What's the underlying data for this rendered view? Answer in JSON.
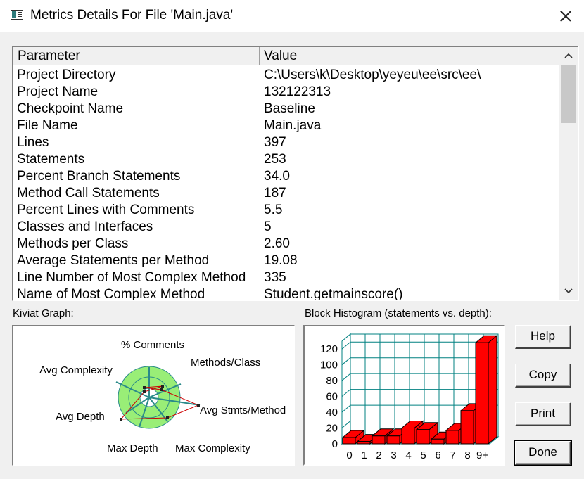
{
  "window": {
    "title": "Metrics Details For File 'Main.java'"
  },
  "table": {
    "headers": {
      "parameter": "Parameter",
      "value": "Value"
    },
    "rows": [
      {
        "p": "Project Directory",
        "v": "C:\\Users\\k\\Desktop\\yeyeu\\ee\\src\\ee\\"
      },
      {
        "p": "Project Name",
        "v": "132122313"
      },
      {
        "p": "Checkpoint Name",
        "v": "Baseline"
      },
      {
        "p": "File Name",
        "v": "Main.java"
      },
      {
        "p": "Lines",
        "v": "397"
      },
      {
        "p": "Statements",
        "v": "253"
      },
      {
        "p": "Percent Branch Statements",
        "v": "34.0"
      },
      {
        "p": "Method Call Statements",
        "v": "187"
      },
      {
        "p": "Percent Lines with Comments",
        "v": "5.5"
      },
      {
        "p": "Classes and Interfaces",
        "v": "5"
      },
      {
        "p": "Methods per Class",
        "v": "2.60"
      },
      {
        "p": "Average Statements per Method",
        "v": "19.08"
      },
      {
        "p": "Line Number of Most Complex Method",
        "v": "335"
      },
      {
        "p": "Name of Most Complex Method",
        "v": "Student.getmainscore()"
      }
    ]
  },
  "kiviat": {
    "label": "Kiviat Graph:",
    "axes": [
      "% Comments",
      "Methods/Class",
      "Avg Stmts/Method",
      "Max Complexity",
      "Max Depth",
      "Avg Depth",
      "Avg Complexity"
    ],
    "colors": {
      "ring": "#99ee77",
      "polygon": "#cc0000",
      "axis": "#2a8a8a"
    }
  },
  "histogram": {
    "label": "Block Histogram (statements vs. depth):",
    "bar_color": "#ff0000",
    "grid_color": "#008080"
  },
  "chart_data": {
    "type": "bar",
    "title": "Block Histogram (statements vs. depth):",
    "categories": [
      "0",
      "1",
      "2",
      "3",
      "4",
      "5",
      "6",
      "7",
      "8",
      "9+"
    ],
    "values": [
      8,
      3,
      10,
      10,
      20,
      18,
      6,
      17,
      42,
      128
    ],
    "yticks": [
      0,
      20,
      40,
      60,
      80,
      100,
      120
    ],
    "ylim": [
      0,
      130
    ],
    "grid": true
  },
  "buttons": {
    "help": "Help",
    "copy": "Copy",
    "print": "Print",
    "done": "Done"
  }
}
